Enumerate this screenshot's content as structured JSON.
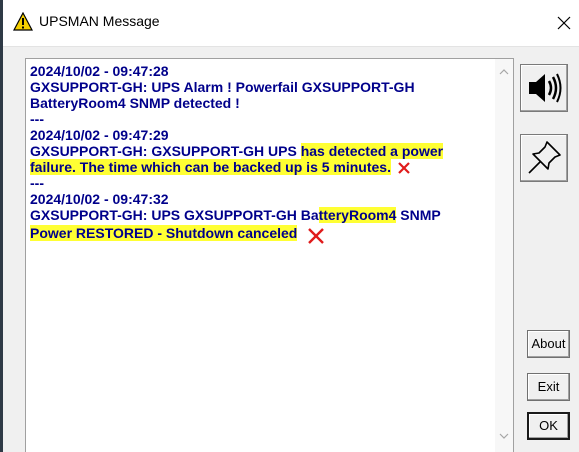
{
  "window": {
    "title": "UPSMAN Message",
    "close_label": "X"
  },
  "messages": [
    {
      "timestamp": "2024/10/02 - 09:47:28",
      "line1": "GXSUPPORT-GH: UPS Alarm ! Powerfail GXSUPPORT-GH",
      "line2": "BatteryRoom4 SNMP detected !"
    },
    {
      "separator": "---",
      "timestamp": "2024/10/02 - 09:47:29",
      "line1_plain": "GXSUPPORT-GH: GXSUPPORT-GH UPS ",
      "line1_highlight": "has detected a power",
      "line2_highlight": "failure. The time which can be backed up is 5 minutes."
    },
    {
      "separator": "---",
      "timestamp": "2024/10/02 - 09:47:32",
      "line1_plain": "GXSUPPORT-GH: UPS GXSUPPORT-GH Ba",
      "line1_highlight": "tteryRoom4",
      "line1_tail": " SNMP",
      "line2_highlight": "Power RESTORED - Shutdown canceled"
    }
  ],
  "buttons": {
    "about": "About",
    "exit": "Exit",
    "ok": "OK"
  },
  "icons": {
    "title": "warning-triangle-icon",
    "speaker": "speaker-icon",
    "pin": "pushpin-icon",
    "annotation": "red-x-mark-icon"
  },
  "colors": {
    "message_text": "#00008b",
    "highlight": "#ffff33",
    "annotation_x": "#e01b1b"
  }
}
